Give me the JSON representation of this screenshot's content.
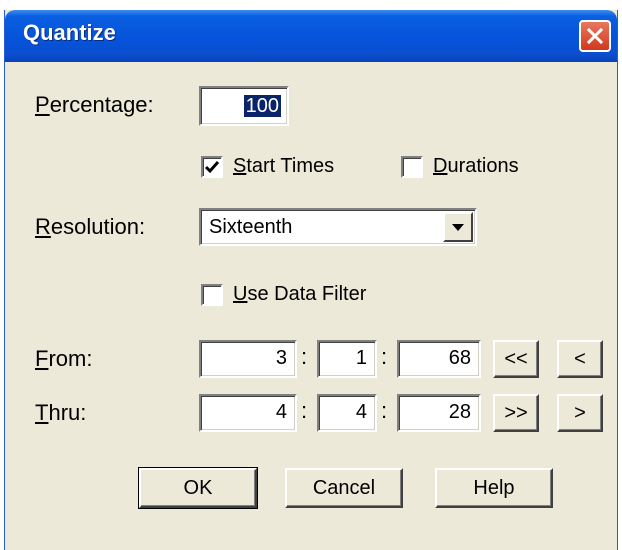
{
  "window": {
    "title": "Quantize"
  },
  "percentage": {
    "label_first": "P",
    "label_rest": "ercentage:",
    "value": "100"
  },
  "start_times": {
    "label_first": "S",
    "label_rest": "tart Times",
    "checked": true
  },
  "durations": {
    "label_first": "D",
    "label_rest": "urations",
    "checked": false
  },
  "resolution": {
    "label_first": "R",
    "label_rest": "esolution:",
    "value": "Sixteenth"
  },
  "data_filter": {
    "label_first": "U",
    "label_rest": "se Data Filter",
    "checked": false
  },
  "from": {
    "label_first": "F",
    "label_rest": "rom:",
    "measure": "3",
    "beat": "1",
    "tick": "68",
    "btn_first": "<<",
    "btn_prev": "<"
  },
  "thru": {
    "label_first": "T",
    "label_rest": "hru:",
    "measure": "4",
    "beat": "4",
    "tick": "28",
    "btn_last": ">>",
    "btn_next": ">"
  },
  "separator": ":",
  "buttons": {
    "ok": "OK",
    "cancel": "Cancel",
    "help": "Help"
  }
}
